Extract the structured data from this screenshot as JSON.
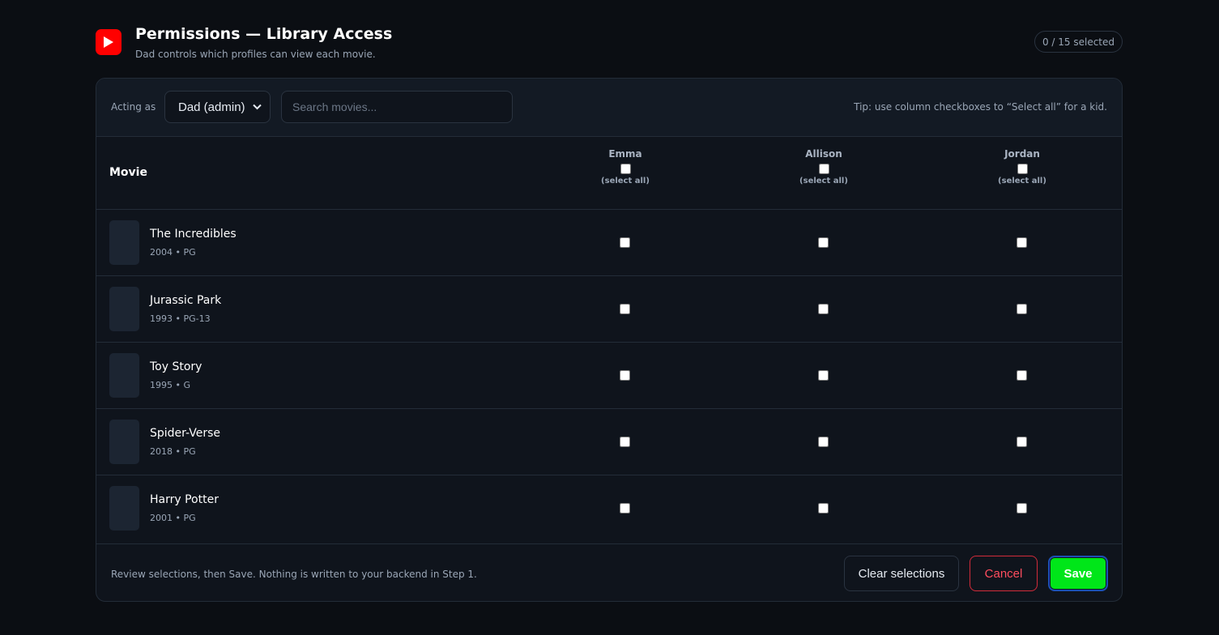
{
  "header": {
    "title": "Permissions — Library Access",
    "subtitle": "Dad controls which profiles can view each movie.",
    "selected_count": "0 / 15 selected",
    "logo_color": "#ff0000"
  },
  "toolbar": {
    "acting_label": "Acting as",
    "acting_value": "Dad (admin)",
    "search_placeholder": "Search movies...",
    "tip": "Tip: use column checkboxes to “Select all” for a kid."
  },
  "table": {
    "movie_header": "Movie",
    "profiles": [
      {
        "name": "Emma",
        "select_all": "(select all)"
      },
      {
        "name": "Allison",
        "select_all": "(select all)"
      },
      {
        "name": "Jordan",
        "select_all": "(select all)"
      }
    ],
    "movies": [
      {
        "title": "The Incredibles",
        "meta": "2004 • PG"
      },
      {
        "title": "Jurassic Park",
        "meta": "1993 • PG-13"
      },
      {
        "title": "Toy Story",
        "meta": "1995 • G"
      },
      {
        "title": "Spider-Verse",
        "meta": "2018 • PG"
      },
      {
        "title": "Harry Potter",
        "meta": "2001 • PG"
      }
    ]
  },
  "footer": {
    "note": "Review selections, then Save. Nothing is written to your backend in Step 1.",
    "clear_label": "Clear selections",
    "cancel_label": "Cancel",
    "save_label": "Save"
  },
  "colors": {
    "accent_save": "#00e619",
    "cancel": "#ff4d5e",
    "background": "#0b0e13"
  }
}
